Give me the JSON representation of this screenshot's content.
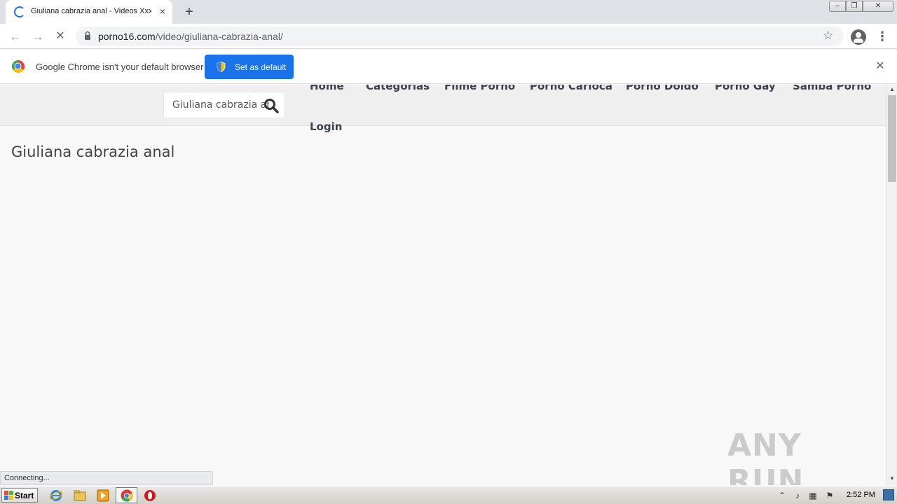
{
  "browser": {
    "tab_title": "Giuliana cabrazia anal - Videos Xxx |",
    "tab_close_icon": "×",
    "new_tab_icon": "+",
    "window_controls": {
      "minimize": "–",
      "maximize": "❐",
      "close": "✕"
    },
    "nav": {
      "back_icon": "←",
      "forward_icon": "→",
      "stop_icon": "✕"
    },
    "url_domain": "porno16.com",
    "url_path": "/video/giuliana-cabrazia-anal/",
    "star_icon": "☆",
    "menu_icon": "⋮"
  },
  "infobar": {
    "message": "Google Chrome isn't your default browser",
    "button_label": "Set as default",
    "close_icon": "✕"
  },
  "site": {
    "search_value": "Giuliana cabrazia anal",
    "nav_links": [
      "Home",
      "Categorias",
      "Filme Porno",
      "Porno Carioca",
      "Porno Doido",
      "Porno Gay",
      "Samba Porno"
    ],
    "login": "Login",
    "page_title": "Giuliana cabrazia anal"
  },
  "status_bar": {
    "text": "Connecting..."
  },
  "watermark": "ANY RUN",
  "scrollbar": {
    "up_icon": "▲",
    "down_icon": "▼"
  },
  "taskbar": {
    "start_label": "Start",
    "tray_expand_icon": "⌃",
    "tray_volume_icon": "♪",
    "tray_network_icon": "▦",
    "tray_flag_icon": "⚑",
    "clock": "2:52 PM"
  }
}
